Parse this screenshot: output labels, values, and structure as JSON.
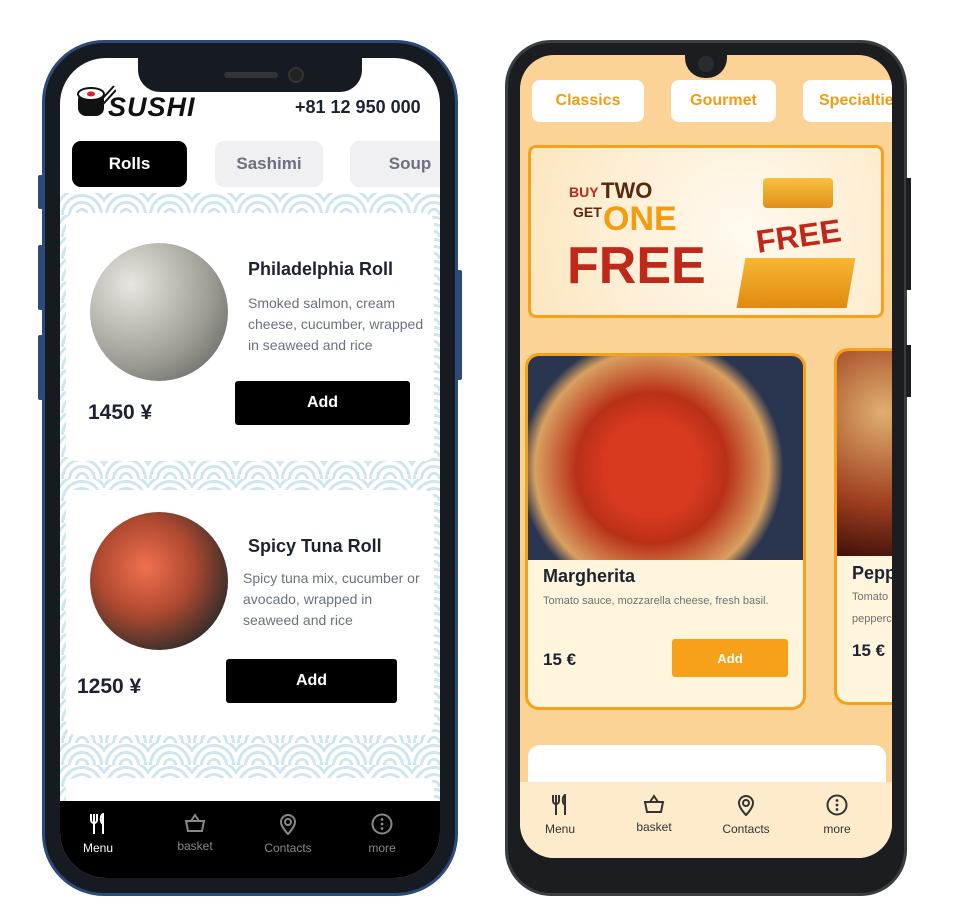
{
  "sushi": {
    "logo": "SUSHI",
    "phone": "+81 12 950 000",
    "tabs": [
      {
        "label": "Rolls",
        "active": true
      },
      {
        "label": "Sashimi"
      },
      {
        "label": "Soup"
      }
    ],
    "items": [
      {
        "name": "Philadelphia Roll",
        "description": "Smoked salmon, cream cheese, cucumber, wrapped in seaweed and rice",
        "price": "1450 ¥",
        "add": "Add"
      },
      {
        "name": "Spicy Tuna Roll",
        "description": "Spicy tuna mix, cucumber or avocado, wrapped in seaweed and rice",
        "price": "1250 ¥",
        "add": "Add"
      }
    ],
    "nav": [
      {
        "label": "Menu",
        "icon": "fork-knife-icon"
      },
      {
        "label": "basket",
        "icon": "basket-icon"
      },
      {
        "label": "Contacts",
        "icon": "location-pin-icon"
      },
      {
        "label": "more",
        "icon": "more-icon"
      }
    ]
  },
  "pizza": {
    "tabs": [
      {
        "label": "Classics"
      },
      {
        "label": "Gourmet"
      },
      {
        "label": "Specialties"
      }
    ],
    "banner": {
      "buy": "BUY",
      "two": "TWO",
      "get": "GET",
      "one": "ONE",
      "free": "FREE",
      "gift": "FREE"
    },
    "items": [
      {
        "name": "Margherita",
        "description": "Tomato sauce, mozzarella cheese, fresh basil.",
        "price": "15 €",
        "add": "Add"
      },
      {
        "name": "Pepp",
        "description": "Tomato",
        "description2": "pepperc",
        "price": "15 €"
      }
    ],
    "nav": [
      {
        "label": "Menu",
        "icon": "fork-knife-icon"
      },
      {
        "label": "basket",
        "icon": "basket-icon"
      },
      {
        "label": "Contacts",
        "icon": "location-pin-icon"
      },
      {
        "label": "more",
        "icon": "more-icon"
      }
    ],
    "colors": {
      "accent": "#f7a11a",
      "background": "#fbd396",
      "card": "#fff5dc"
    }
  }
}
